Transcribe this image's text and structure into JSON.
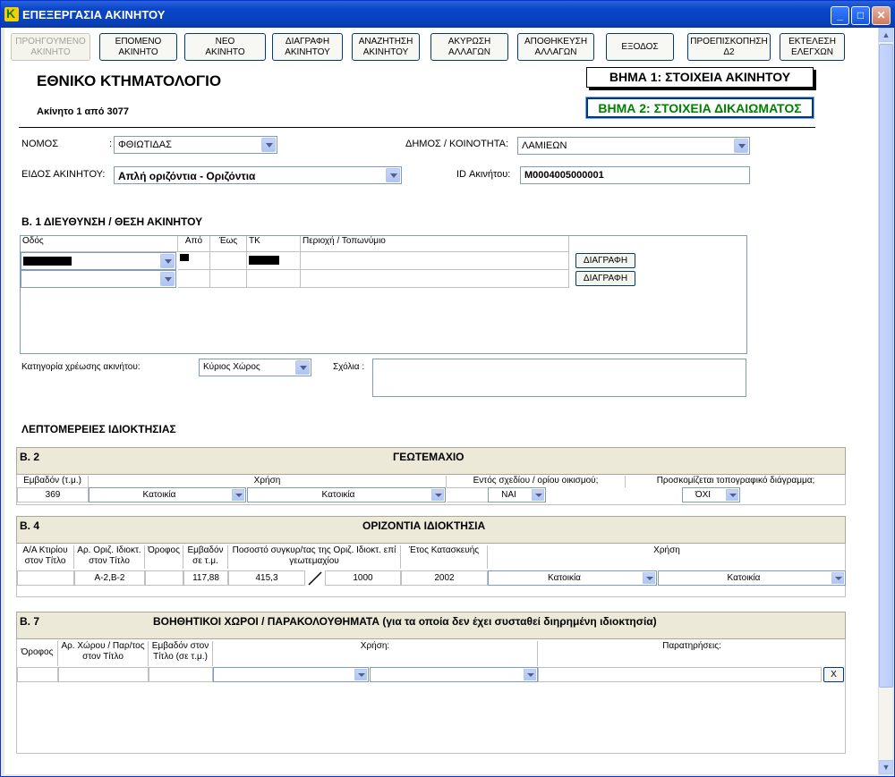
{
  "window": {
    "title": "ΕΠΕΞΕΡΓΑΣΙΑ ΑΚΙΝΗΤΟΥ"
  },
  "toolbar": [
    {
      "l1": "ΠΡΟΗΓΟΥΜΕΝΟ",
      "l2": "ΑΚΙΝΗΤΟ"
    },
    {
      "l1": "ΕΠΟΜΕΝΟ",
      "l2": "ΑΚΙΝΗΤΟ"
    },
    {
      "l1": "ΝΕΟ",
      "l2": "ΑΚΙΝΗΤΟ"
    },
    {
      "l1": "ΔΙΑΓΡΑΦΗ",
      "l2": "ΑΚΙΝΗΤΟΥ"
    },
    {
      "l1": "ΑΝΑΖΗΤΗΣΗ",
      "l2": "ΑΚΙΝΗΤΟΥ"
    },
    {
      "l1": "ΑΚΥΡΩΣΗ",
      "l2": "ΑΛΛΑΓΩΝ"
    },
    {
      "l1": "ΑΠΟΘΗΚΕΥΣΗ",
      "l2": "ΑΛΛΑΓΩΝ"
    },
    {
      "l1": "ΕΞΟΔΟΣ",
      "l2": ""
    },
    {
      "l1": "ΠΡΟΕΠΙΣΚΟΠΗΣΗ",
      "l2": "Δ2"
    },
    {
      "l1": "ΕΚΤΕΛΕΣΗ",
      "l2": "ΕΛΕΓΧΩΝ"
    }
  ],
  "header": {
    "title": "ΕΘΝΙΚΟ ΚΤΗΜΑΤΟΛΟΓΙΟ",
    "record": "Ακίνητο 1 από 3077",
    "step1": "ΒΗΜΑ 1: ΣΤΟΙΧΕΙΑ ΑΚΙΝΗΤΟΥ",
    "step2": "ΒΗΜΑ 2: ΣΤΟΙΧΕΙΑ ΔΙΚΑΙΩΜΑΤΟΣ",
    "step2_color": "#008000"
  },
  "form": {
    "nomos_label": "ΝΟΜΟΣ",
    "nomos_colon": ":",
    "nomos_value": "ΦΘΙΩΤΙΔΑΣ",
    "dimos_label": "ΔΗΜΟΣ / ΚΟΙΝΟΤΗΤΑ:",
    "dimos_value": "ΛΑΜΙΕΩΝ",
    "eidos_label": "ΕΙΔΟΣ ΑΚΙΝΗΤΟΥ:",
    "eidos_value": "Απλή οριζόντια - Οριζόντια",
    "id_label": "ID Ακινήτου:",
    "id_value": "M0004005000001"
  },
  "b1": {
    "title": "Β. 1 ΔΙΕΥΘΥΝΣΗ / ΘΕΣΗ ΑΚΙΝΗΤΟΥ",
    "col_odos": "Οδός",
    "col_apo": "Από",
    "col_eos": "Έως",
    "col_tk": "ΤΚ",
    "col_perioxi": "Περιοχή / Τοπωνύμιο",
    "delete_label": "ΔΙΑΓΡΑΦΗ",
    "category_label": "Κατηγορία χρέωσης ακινήτου:",
    "category_value": "Κύριος Χώρος",
    "comments_label": "Σχόλια :"
  },
  "ownership_title": "ΛΕΠΤΟΜΕΡΕΙΕΣ ΙΔΙΟΚΤΗΣΙΑΣ",
  "b2": {
    "code": "Β. 2",
    "title": "ΓΕΩΤΕΜΑΧΙΟ",
    "h_area": "Εμβαδόν (τ.μ.)",
    "h_use": "Χρήση",
    "h_within": "Εντός σχεδίου / ορίου οικισμού;",
    "h_topo": "Προσκομίζεται τοπογραφικό διάγραμμα;",
    "area": "369",
    "use1": "Κατοικία",
    "use2": "Κατοικία",
    "within": "ΝΑΙ",
    "topo": "ΌΧΙ"
  },
  "b4": {
    "code": "Β. 4",
    "title": "ΟΡΙΖΟΝΤΙΑ ΙΔΙΟΚΤΗΣΙΑ",
    "h_aa": "Α/Α Κτιρίου στον Τίτλο",
    "h_ar": "Αρ. Οριζ. Ιδιοκτ. στον Τίτλο",
    "h_floor": "Όροφος",
    "h_area": "Εμβαδόν σε τ.μ.",
    "h_pct": "Ποσοστό συγκυρ/τας της Οριζ. Ιδιοκτ. επί γεωτεμαχίου",
    "h_year": "Έτος Κατασκευής",
    "h_use": "Χρήση",
    "ar": "Α-2,Β-2",
    "area": "117,88",
    "pct_num": "415,3",
    "pct_den": "1000",
    "year": "2002",
    "use1": "Κατοικία",
    "use2": "Κατοικία"
  },
  "b7": {
    "code": "Β. 7",
    "title": "ΒΟΗΘΗΤΙΚΟΙ ΧΩΡΟΙ / ΠΑΡΑΚΟΛΟΥΘΗΜΑΤΑ (για τα οποία δεν έχει συσταθεί διηρημένη ιδιοκτησία)",
    "h_floor": "Όροφος",
    "h_ar": "Αρ. Χώρου / Παρ/τος στον Τίτλο",
    "h_area": "Εμβαδόν στον Τίτλο (σε τ.μ.)",
    "h_use": "Χρήση:",
    "h_notes": "Παρατηρήσεις:",
    "x_label": "X"
  }
}
